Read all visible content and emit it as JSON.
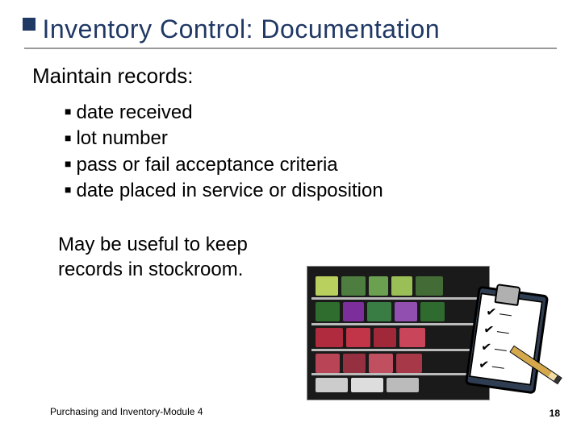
{
  "title": "Inventory Control: Documentation",
  "subhead": "Maintain records:",
  "bullets": [
    "date received",
    "lot number",
    "pass or fail acceptance criteria",
    "date placed in service or disposition"
  ],
  "note": "May be useful to keep records in stockroom.",
  "footer": "Purchasing and Inventory-Module 4",
  "page_number": "18",
  "clipboard_lines": [
    "✔ —",
    "✔ —",
    "✔ —",
    "✔ —"
  ]
}
